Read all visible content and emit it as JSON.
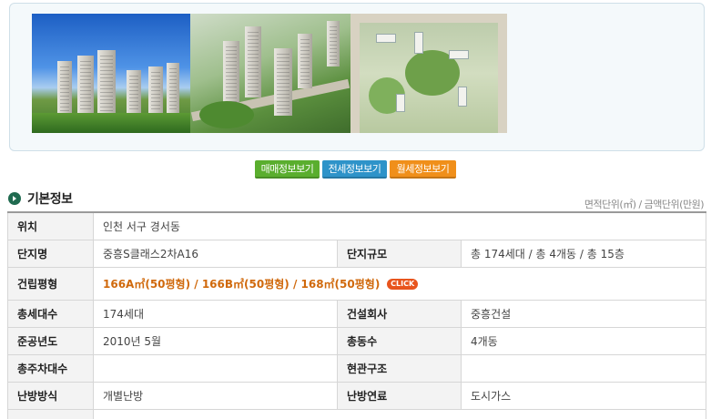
{
  "buttons": {
    "sale": "매매정보보기",
    "jeonse": "전세정보보기",
    "wolse": "월세정보보기"
  },
  "section": {
    "title": "기본정보",
    "unit_note": "면적단위(㎡) / 금액단위(만원)"
  },
  "rows": {
    "location": {
      "label": "위치",
      "value": "인천 서구 경서동"
    },
    "complex_name": {
      "label": "단지명",
      "value": "중흥S클래스2차A16"
    },
    "complex_scale": {
      "label": "단지규모",
      "value": "총 174세대 / 총 4개동 / 총 15층"
    },
    "area": {
      "label": "건립평형",
      "value": "166A㎡(50평형) / 166B㎡(50평형) / 168㎡(50평형)",
      "badge": "CLICK"
    },
    "households": {
      "label": "총세대수",
      "value": "174세대"
    },
    "builder": {
      "label": "건설회사",
      "value": "중흥건설"
    },
    "completion": {
      "label": "준공년도",
      "value": "2010년 5월"
    },
    "buildings": {
      "label": "총동수",
      "value": "4개동"
    },
    "parking": {
      "label": "총주차대수",
      "value": ""
    },
    "entrance": {
      "label": "현관구조",
      "value": ""
    },
    "heating_method": {
      "label": "난방방식",
      "value": "개별난방"
    },
    "heating_fuel": {
      "label": "난방연료",
      "value": "도시가스"
    }
  },
  "colors": {
    "sale_button": "#5aae2e",
    "jeonse_button": "#2e93c9",
    "wolse_button": "#f08f1a",
    "area_text": "#d0690c"
  }
}
